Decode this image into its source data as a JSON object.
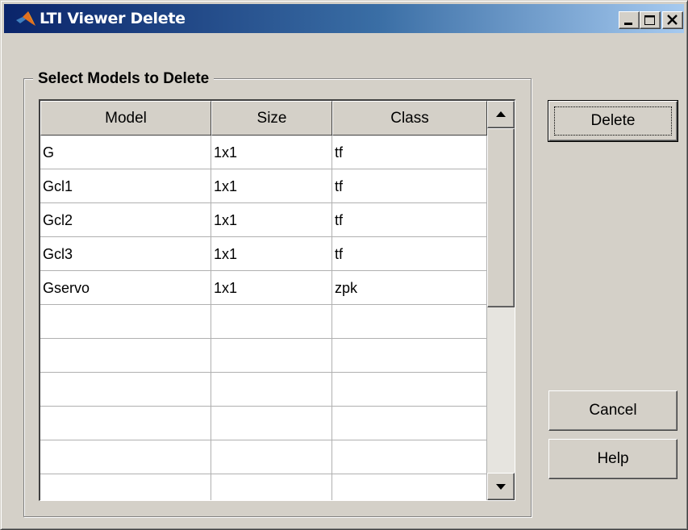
{
  "window": {
    "title": "LTI Viewer Delete",
    "icon": "matlab-logo-icon",
    "controls": {
      "minimize": "minimize-icon",
      "maximize": "maximize-icon",
      "close": "close-icon"
    }
  },
  "group": {
    "title": "Select Models to Delete"
  },
  "table": {
    "headers": [
      "Model",
      "Size",
      "Class"
    ],
    "rows": [
      [
        "G",
        "1x1",
        "tf"
      ],
      [
        "Gcl1",
        "1x1",
        "tf"
      ],
      [
        "Gcl2",
        "1x1",
        "tf"
      ],
      [
        "Gcl3",
        "1x1",
        "tf"
      ],
      [
        "Gservo",
        "1x1",
        "zpk"
      ],
      [
        "",
        "",
        ""
      ],
      [
        "",
        "",
        ""
      ],
      [
        "",
        "",
        ""
      ],
      [
        "",
        "",
        ""
      ],
      [
        "",
        "",
        ""
      ],
      [
        "",
        "",
        ""
      ]
    ]
  },
  "buttons": {
    "delete": "Delete",
    "cancel": "Cancel",
    "help": "Help"
  }
}
